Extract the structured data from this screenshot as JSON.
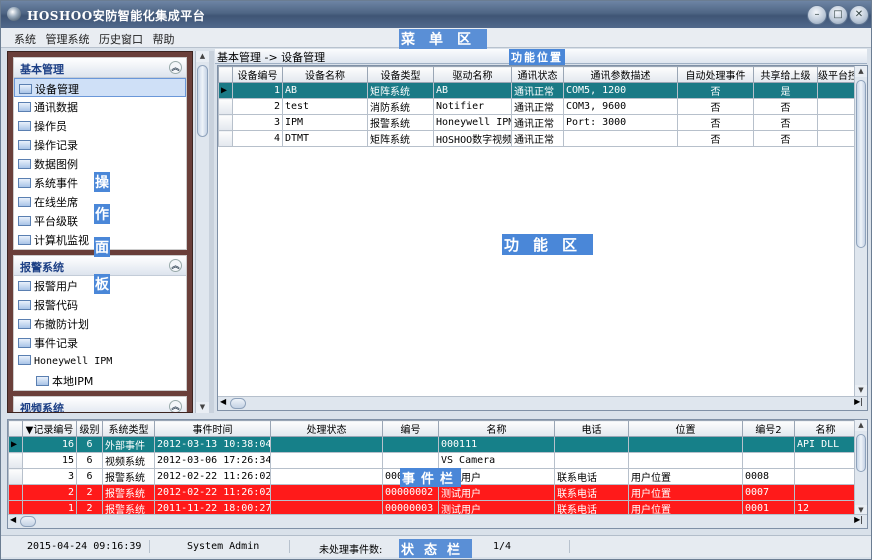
{
  "window": {
    "title": "HOSHOO安防智能化集成平台"
  },
  "menu": {
    "items": [
      "系统",
      "管理系统",
      "历史窗口",
      "帮助"
    ],
    "zone_label": "菜单区"
  },
  "left_panel": {
    "groups": [
      {
        "title": "基本管理",
        "items": [
          "设备管理",
          "通讯数据",
          "操作员",
          "操作记录",
          "数据图例",
          "系统事件",
          "在线坐席",
          "平台级联",
          "计算机监视"
        ]
      },
      {
        "title": "报警系统",
        "items": [
          "报警用户",
          "报警代码",
          "布撤防计划",
          "事件记录",
          "Honeywell IPM"
        ],
        "sub_items": [
          "本地IPM"
        ]
      },
      {
        "title": "视频系统"
      }
    ],
    "zone_chars": [
      "操",
      "作",
      "面",
      "板"
    ]
  },
  "breadcrumb": "基本管理 -> 设备管理",
  "function_zone_tag": "功能位置",
  "function_zone_label": "功能区",
  "device_table": {
    "columns": [
      "设备编号",
      "设备名称",
      "设备类型",
      "驱动名称",
      "通讯状态",
      "通讯参数描述",
      "自动处理事件",
      "共享给上级",
      "级平台控"
    ],
    "rows": [
      [
        "1",
        "AB",
        "矩阵系统",
        "AB",
        "通讯正常",
        "COM5, 1200",
        "否",
        "是",
        ""
      ],
      [
        "2",
        "test",
        "消防系统",
        "Notifier",
        "通讯正常",
        "COM3, 9600",
        "否",
        "否",
        ""
      ],
      [
        "3",
        "IPM",
        "报警系统",
        "Honeywell IPM",
        "通讯正常",
        "Port: 3000",
        "否",
        "否",
        ""
      ],
      [
        "4",
        "DTMT",
        "矩阵系统",
        "HOSHOO数字视频",
        "通讯正常",
        "",
        "否",
        "否",
        ""
      ]
    ]
  },
  "event_table": {
    "columns": [
      "▼记录编号",
      "级别",
      "系统类型",
      "事件时间",
      "处理状态",
      "编号",
      "名称",
      "电话",
      "位置",
      "编号2",
      "名称"
    ],
    "rows": [
      [
        "16",
        "6",
        "外部事件",
        "2012-03-13 10:38:04",
        "",
        "",
        "000111",
        "",
        "",
        "",
        "API DLL"
      ],
      [
        "15",
        "6",
        "视频系统",
        "2012-03-06 17:26:34",
        "",
        "",
        "VS Camera",
        "",
        "",
        "",
        ""
      ],
      [
        "3",
        "6",
        "报警系统",
        "2012-02-22 11:26:02",
        "",
        "00000002",
        "测试用户",
        "联系电话",
        "用户位置",
        "0008",
        ""
      ],
      [
        "2",
        "2",
        "报警系统",
        "2012-02-22 11:26:02",
        "",
        "00000002",
        "测试用户",
        "联系电话",
        "用户位置",
        "0007",
        ""
      ],
      [
        "1",
        "2",
        "报警系统",
        "2011-11-22 18:00:27",
        "",
        "00000003",
        "测试用户",
        "联系电话",
        "用户位置",
        "0001",
        "12"
      ]
    ],
    "zone_label": "事件栏"
  },
  "status": {
    "datetime": "2015-04-24 09:16:39",
    "user": "System Admin",
    "unprocessed_label": "未处理事件数:",
    "page": "1/4",
    "zone_label": "状态栏"
  },
  "colors": {
    "titlebar": "#4e6584",
    "selected_row": "#1a7a86",
    "alarm_row": "#ff1a1a",
    "left_panel_bg": "#6a3f3a",
    "zone_label_bg": "#4a87d8"
  }
}
